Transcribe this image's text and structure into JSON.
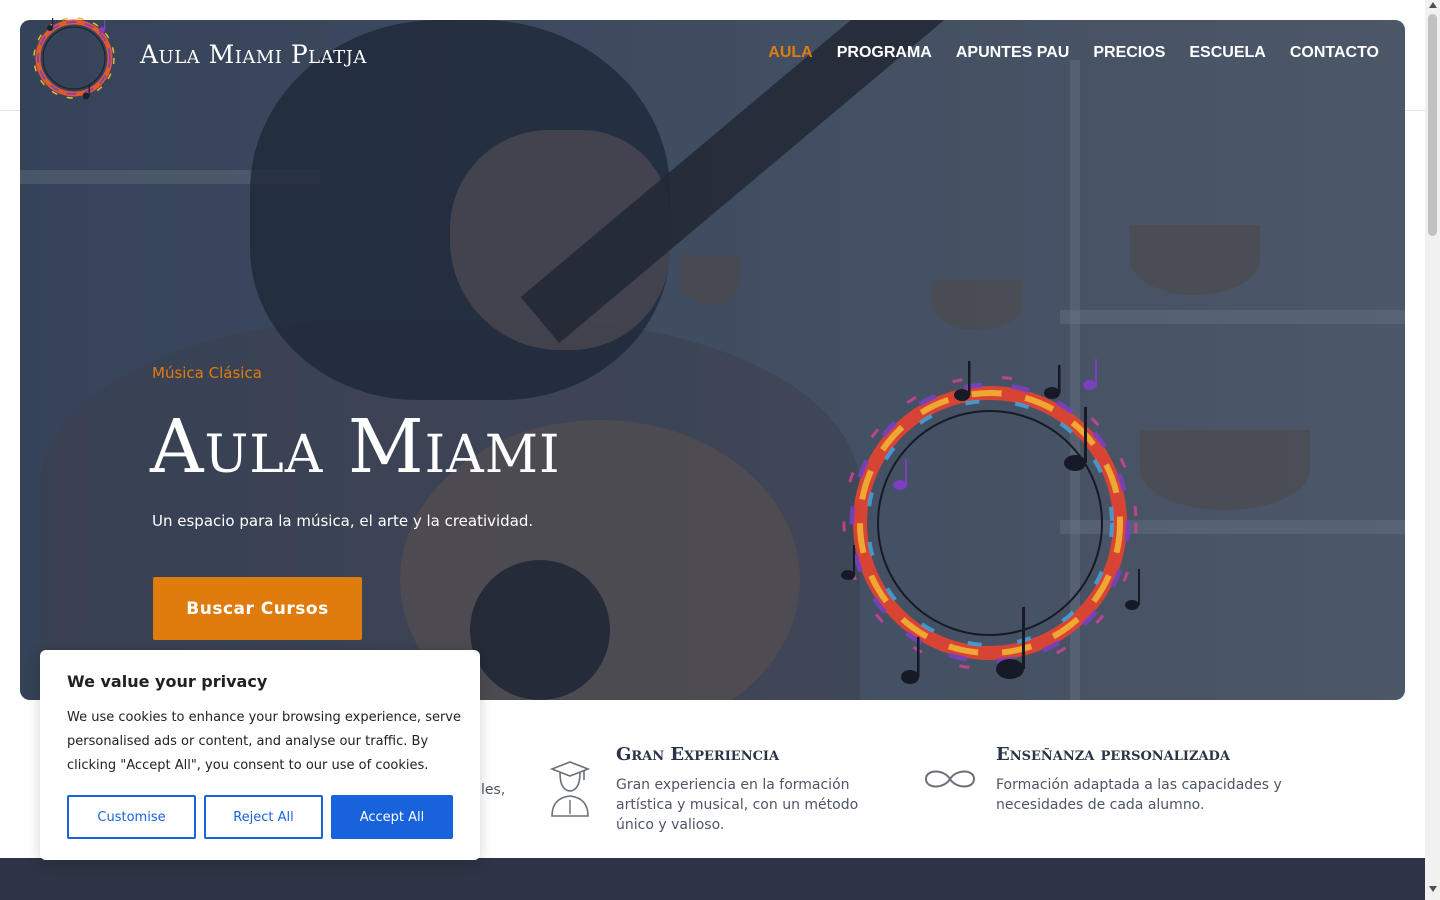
{
  "header": {
    "site_title": "Aula Miami Platja",
    "nav": [
      {
        "label": "AULA",
        "active": true
      },
      {
        "label": "PROGRAMA",
        "active": false
      },
      {
        "label": "APUNTES PAU",
        "active": false
      },
      {
        "label": "PRECIOS",
        "active": false
      },
      {
        "label": "ESCUELA",
        "active": false
      },
      {
        "label": "CONTACTO",
        "active": false
      }
    ]
  },
  "hero": {
    "eyebrow": "Música Clásica",
    "title": "Aula Miami",
    "subtitle": "Un espacio para la música, el arte y la creatividad.",
    "cta_label": "Buscar Cursos"
  },
  "features": [
    {
      "title": "",
      "text": "les,",
      "icon": "music-icon"
    },
    {
      "title": "Gran Experiencia",
      "text": "Gran experiencia en la formación artística y musical, con un método único y valioso.",
      "icon": "graduate-icon"
    },
    {
      "title": "Enseñanza personalizada",
      "text": "Formación adaptada a las capacidades y necesidades de cada alumno.",
      "icon": "infinity-icon"
    }
  ],
  "cookie_banner": {
    "title": "We value your privacy",
    "text": "We use cookies to enhance your browsing experience, serve personalised ads or content, and analyse our traffic. By clicking \"Accept All\", you consent to our use of cookies.",
    "customise_label": "Customise",
    "reject_label": "Reject All",
    "accept_label": "Accept All"
  },
  "colors": {
    "accent": "#e07c0e",
    "heading": "#2a3446",
    "cookie_blue": "#1863dc",
    "footer_band": "#2d3445"
  }
}
